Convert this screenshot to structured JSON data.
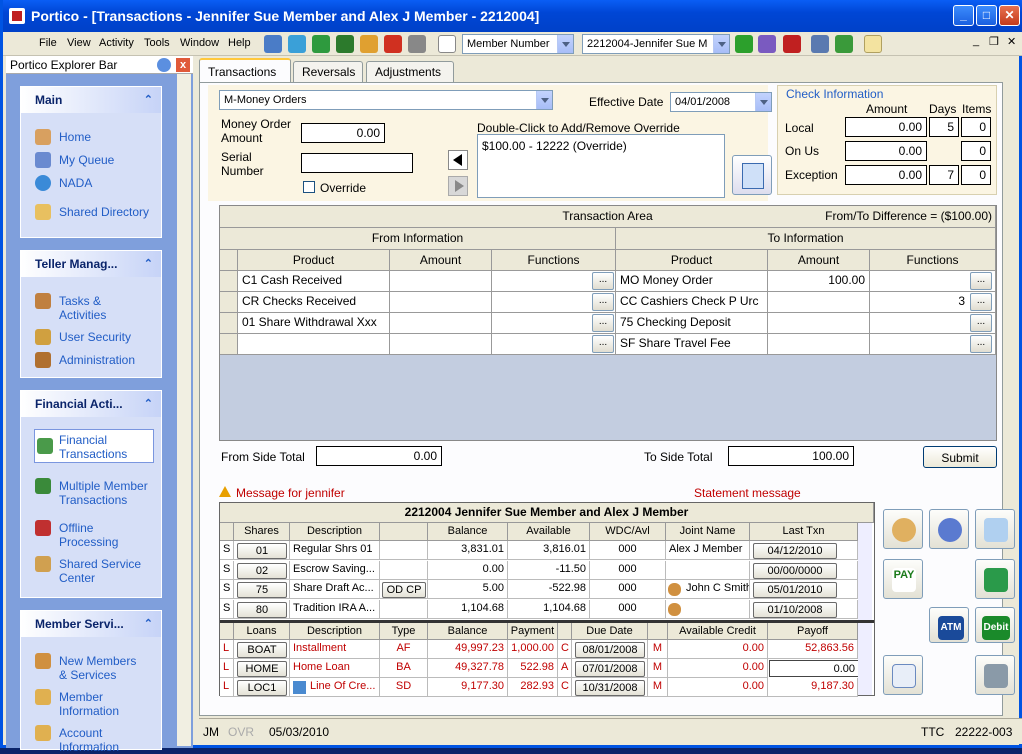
{
  "title": "Portico - [Transactions - Jennifer Sue Member and Alex J Member - 2212004]",
  "window_buttons": {
    "minimize": "_",
    "maximize": "□",
    "close": "✕"
  },
  "menu": [
    "File",
    "View",
    "Activity",
    "Tools",
    "Window",
    "Help"
  ],
  "toolbar": {
    "search_field": "Member Number",
    "member_combo": "2212004-Jennifer Sue M",
    "mdi_buttons": {
      "minimize": "_",
      "restore": "❐",
      "close": "✕"
    }
  },
  "explorer": {
    "title": "Portico Explorer Bar",
    "sections": [
      {
        "title": "Main",
        "items": [
          "Home",
          "My Queue",
          "NADA",
          "Shared Directory"
        ]
      },
      {
        "title": "Teller Manag...",
        "items": [
          "Tasks &\nActivities",
          "User Security",
          "Administration"
        ]
      },
      {
        "title": "Financial Acti...",
        "items": [
          "Financial\nTransactions",
          "Multiple Member\nTransactions",
          "Offline\nProcessing",
          "Shared Service\nCenter"
        ]
      },
      {
        "title": "Member Servi...",
        "items": [
          "New Members\n& Services",
          "Member\nInformation",
          "Account\nInformation"
        ]
      }
    ],
    "chevron": "⌃"
  },
  "tabs": [
    "Transactions",
    "Reversals",
    "Adjustments"
  ],
  "form": {
    "transaction_type": "M-Money Orders",
    "effective_date_label": "Effective Date",
    "effective_date": "04/01/2008",
    "money_order_amount_label": "Money Order\nAmount",
    "money_order_amount": "0.00",
    "serial_number_label": "Serial\nNumber",
    "serial_number": "",
    "override_label": "Override",
    "override_list_label": "Double-Click to Add/Remove Override",
    "override_list": [
      "$100.00 - 12222 (Override)"
    ]
  },
  "check_info": {
    "title": "Check Information",
    "headers": [
      "Amount",
      "Days",
      "Items"
    ],
    "rows": [
      {
        "label": "Local",
        "amount": "0.00",
        "days": "5",
        "items": "0"
      },
      {
        "label": "On Us",
        "amount": "0.00",
        "days": "",
        "items": "0"
      },
      {
        "label": "Exception",
        "amount": "0.00",
        "days": "7",
        "items": "0"
      }
    ]
  },
  "transaction_area": {
    "title": "Transaction Area",
    "difference": "From/To Difference = ($100.00)",
    "from_header": "From Information",
    "to_header": "To Information",
    "columns": [
      "Product",
      "Amount",
      "Functions"
    ],
    "from_rows": [
      {
        "product": "C1 Cash Received",
        "amount": "",
        "functions": ""
      },
      {
        "product": "CR Checks Received",
        "amount": "",
        "functions": ""
      },
      {
        "product": "01 Share Withdrawal Xxx",
        "amount": "",
        "functions": ""
      },
      {
        "product": "",
        "amount": "",
        "functions": ""
      }
    ],
    "to_rows": [
      {
        "product": "MO Money Order",
        "amount": "100.00",
        "functions": ""
      },
      {
        "product": "CC Cashiers Check P Urc",
        "amount": "",
        "functions": "3"
      },
      {
        "product": "75 Checking Deposit",
        "amount": "",
        "functions": ""
      },
      {
        "product": "SF Share Travel Fee",
        "amount": "",
        "functions": ""
      }
    ],
    "ellipsis": "...",
    "from_total_label": "From Side Total",
    "from_total": "0.00",
    "to_total_label": "To Side Total",
    "to_total": "100.00",
    "submit": "Submit"
  },
  "messages": {
    "member_message": "Message for jennifer",
    "statement_message": "Statement message"
  },
  "member_grid": {
    "title": "2212004  Jennifer Sue Member and Alex J Member",
    "share_headers": [
      "Shares",
      "Description",
      "",
      "Balance",
      "Available",
      "WDC/Avl",
      "Joint Name",
      "Last Txn"
    ],
    "shares": [
      {
        "type": "S",
        "id": "01",
        "desc": "Regular Shrs 01",
        "extra": "",
        "balance": "3,831.01",
        "available": "3,816.01",
        "wdc": "000",
        "joint": "Alex J Member",
        "last": "04/12/2010"
      },
      {
        "type": "S",
        "id": "02",
        "desc": "Escrow Saving...",
        "extra": "",
        "balance": "0.00",
        "available": "-11.50",
        "wdc": "000",
        "joint": "",
        "last": "00/00/0000"
      },
      {
        "type": "S",
        "id": "75",
        "desc": "Share Draft Ac...",
        "extra": "OD CP",
        "balance": "5.00",
        "available": "-522.98",
        "wdc": "000",
        "joint": "John C Smith",
        "last": "05/01/2010"
      },
      {
        "type": "S",
        "id": "80",
        "desc": "Tradition IRA A...",
        "extra": "",
        "balance": "1,104.68",
        "available": "1,104.68",
        "wdc": "000",
        "joint": "",
        "last": "01/10/2008"
      }
    ],
    "loan_headers": [
      "Loans",
      "Description",
      "Type",
      "Balance",
      "Payment",
      "",
      "Due Date",
      "",
      "Available Credit",
      "Payoff"
    ],
    "loans": [
      {
        "type": "L",
        "id": "BOAT",
        "desc": "Installment",
        "ltype": "AF",
        "balance": "49,997.23",
        "payment": "1,000.00",
        "flag": "C",
        "due": "08/01/2008",
        "m": "M",
        "credit": "0.00",
        "payoff": "52,863.56"
      },
      {
        "type": "L",
        "id": "HOME",
        "desc": "Home Loan",
        "ltype": "BA",
        "balance": "49,327.78",
        "payment": "522.98",
        "flag": "A",
        "due": "07/01/2008",
        "m": "M",
        "credit": "0.00",
        "payoff": "0.00"
      },
      {
        "type": "L",
        "id": "LOC1",
        "desc": "Line Of Cre...",
        "ltype": "SD",
        "balance": "9,177.30",
        "payment": "282.93",
        "flag": "C",
        "due": "10/31/2008",
        "m": "M",
        "credit": "0.00",
        "payoff": "9,187.30"
      }
    ]
  },
  "side_buttons": {
    "pay": "PAY",
    "atm": "ATM",
    "debit": "Debit"
  },
  "status": {
    "user": "JM",
    "ovr": "OVR",
    "date": "05/03/2010",
    "ttc": "TTC",
    "code": "22222-003"
  }
}
